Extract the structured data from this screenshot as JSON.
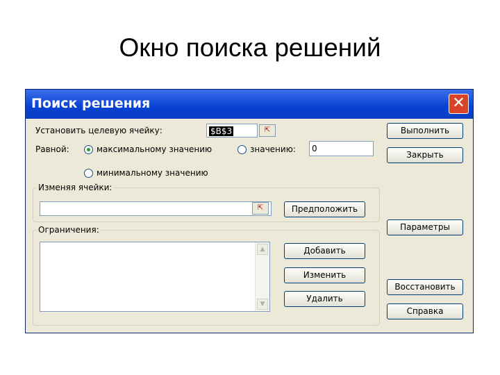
{
  "slide": {
    "title": "Окно поиска решений"
  },
  "dialog": {
    "title": "Поиск решения",
    "target_cell": {
      "label": "Установить целевую ячейку:",
      "value": "$B$3"
    },
    "equal": {
      "label": "Равной:",
      "max_label": "максимальному значению",
      "value_label": "значению:",
      "value_input": "0",
      "min_label": "минимальному значению"
    },
    "changing": {
      "legend": "Изменяя ячейки:",
      "value": "",
      "guess_button": "Предположить"
    },
    "constraints": {
      "legend": "Ограничения:",
      "add_button": "Добавить",
      "change_button": "Изменить",
      "delete_button": "Удалить"
    },
    "buttons": {
      "run": "Выполнить",
      "close": "Закрыть",
      "options": "Параметры",
      "reset": "Восстановить",
      "help": "Справка"
    },
    "icons": {
      "close": "close-icon",
      "collapse": "collapse-dialog-icon",
      "scroll_up": "scroll-up-icon",
      "scroll_down": "scroll-down-icon"
    }
  }
}
